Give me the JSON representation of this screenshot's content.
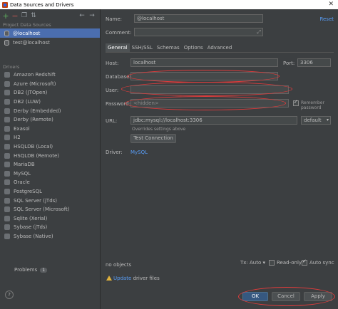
{
  "window": {
    "title": "Data Sources and Drivers"
  },
  "left": {
    "section_project": "Project Data Sources",
    "data_sources": [
      {
        "label": "@localhost",
        "selected": true
      },
      {
        "label": "test@localhost",
        "selected": false
      }
    ],
    "section_drivers": "Drivers",
    "drivers": [
      "Amazon Redshift",
      "Azure (Microsoft)",
      "DB2 (JTOpen)",
      "DB2 (LUW)",
      "Derby (Embedded)",
      "Derby (Remote)",
      "Exasol",
      "H2",
      "HSQLDB (Local)",
      "HSQLDB (Remote)",
      "MariaDB",
      "MySQL",
      "Oracle",
      "PostgreSQL",
      "SQL Server (jTds)",
      "SQL Server (Microsoft)",
      "Sqlite (Xerial)",
      "Sybase (jTds)",
      "Sybase (Native)"
    ],
    "problems_label": "Problems",
    "problems_count": "1",
    "help": "?"
  },
  "form": {
    "name_label": "Name:",
    "name_value": "@localhost",
    "reset_label": "Reset",
    "comment_label": "Comment:",
    "tabs": [
      "General",
      "SSH/SSL",
      "Schemas",
      "Options",
      "Advanced"
    ],
    "host_label": "Host:",
    "host_value": "localhost",
    "port_label": "Port:",
    "port_value": "3306",
    "database_label": "Database:",
    "user_label": "User:",
    "password_label": "Password:",
    "password_placeholder": "<hidden>",
    "remember_password": "Remember password",
    "url_label": "URL:",
    "url_value": "jdbc:mysql://localhost:3306",
    "url_mode": "default",
    "url_note": "Overrides settings above",
    "test_connection": "Test Connection",
    "driver_label": "Driver:",
    "driver_value": "MySQL",
    "no_objects": "no objects",
    "tx_label": "Tx: Auto",
    "readonly_label": "Read-only",
    "autosync_label": "Auto sync",
    "update_prefix": "Update",
    "update_suffix": " driver files"
  },
  "buttons": {
    "ok": "OK",
    "cancel": "Cancel",
    "apply": "Apply"
  },
  "colors": {
    "accent": "#4b6eaf",
    "annotation": "#e03c3c",
    "link": "#589df6"
  }
}
